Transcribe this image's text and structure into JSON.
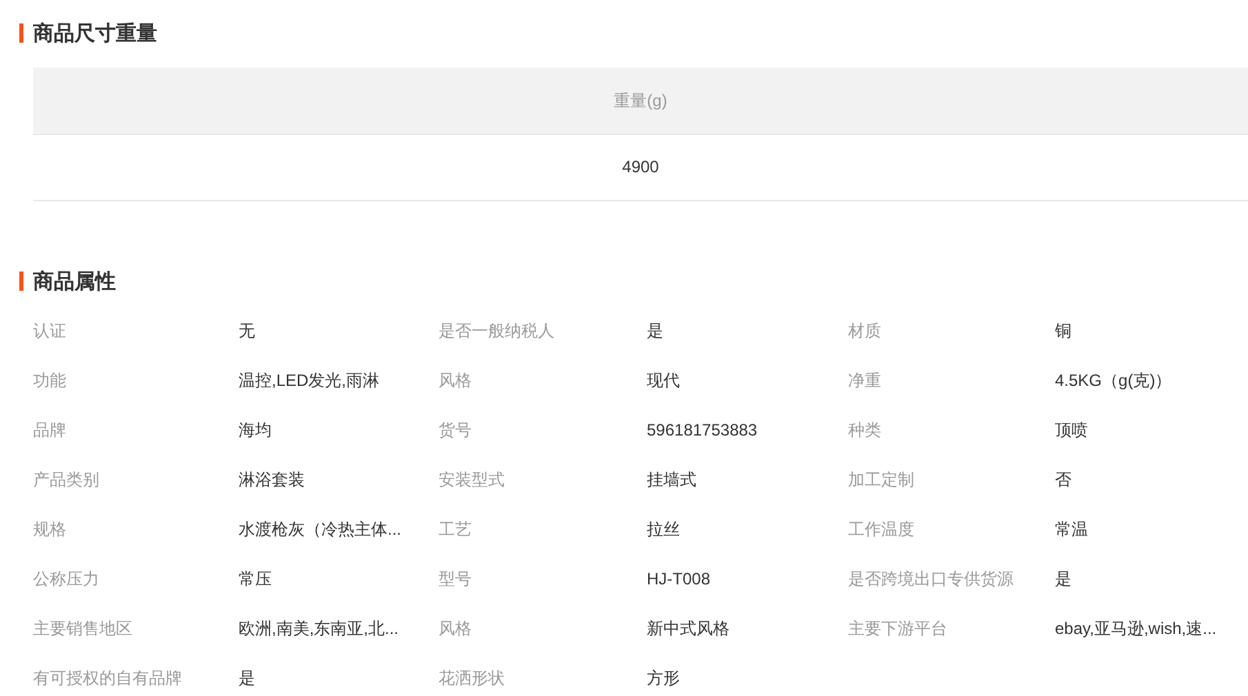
{
  "size_section": {
    "title": "商品尺寸重量",
    "table": {
      "columns": [
        "重量(g)"
      ],
      "rows": [
        [
          "4900"
        ]
      ]
    }
  },
  "attributes_section": {
    "title": "商品属性",
    "attributes": [
      {
        "label": "认证",
        "value": "无"
      },
      {
        "label": "是否一般纳税人",
        "value": "是"
      },
      {
        "label": "材质",
        "value": "铜"
      },
      {
        "label": "功能",
        "value": "温控,LED发光,雨淋"
      },
      {
        "label": "风格",
        "value": "现代"
      },
      {
        "label": "净重",
        "value": "4.5KG（g(克)）"
      },
      {
        "label": "品牌",
        "value": "海均"
      },
      {
        "label": "货号",
        "value": "596181753883"
      },
      {
        "label": "种类",
        "value": "顶喷"
      },
      {
        "label": "产品类别",
        "value": "淋浴套装"
      },
      {
        "label": "安装型式",
        "value": "挂墙式"
      },
      {
        "label": "加工定制",
        "value": "否"
      },
      {
        "label": "规格",
        "value": "水渡枪灰（冷热主体..."
      },
      {
        "label": "工艺",
        "value": "拉丝"
      },
      {
        "label": "工作温度",
        "value": "常温"
      },
      {
        "label": "公称压力",
        "value": "常压"
      },
      {
        "label": "型号",
        "value": "HJ-T008"
      },
      {
        "label": "是否跨境出口专供货源",
        "value": "是"
      },
      {
        "label": "主要销售地区",
        "value": "欧洲,南美,东南亚,北..."
      },
      {
        "label": "风格",
        "value": "新中式风格"
      },
      {
        "label": "主要下游平台",
        "value": "ebay,亚马逊,wish,速..."
      },
      {
        "label": "有可授权的自有品牌",
        "value": "是"
      },
      {
        "label": "花洒形状",
        "value": "方形"
      }
    ]
  }
}
